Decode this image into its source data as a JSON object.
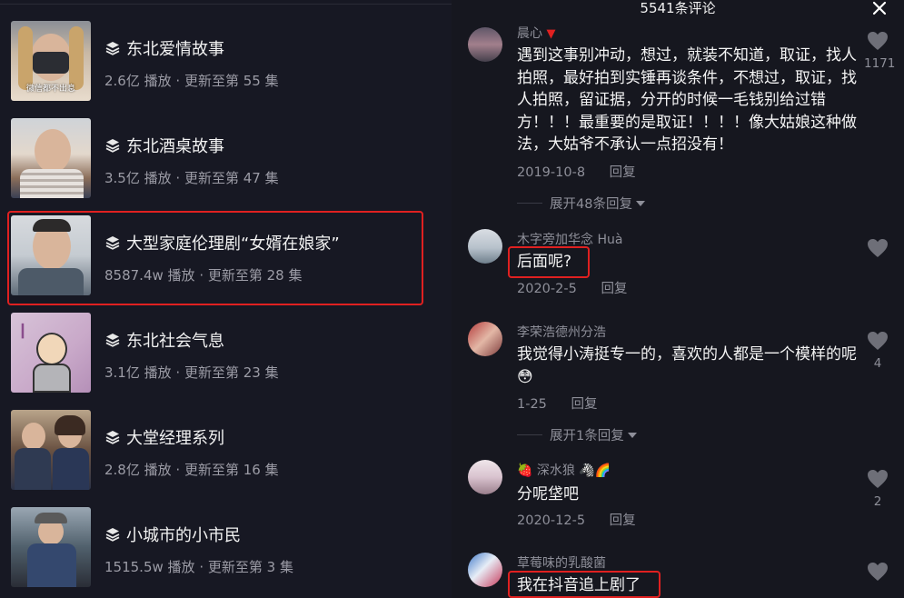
{
  "series": {
    "items": [
      {
        "title": "东北爱情故事",
        "plays": "2.6亿 播放",
        "update": "更新至第 55 集",
        "thumb_caption": "微信都不出息"
      },
      {
        "title": "东北酒桌故事",
        "plays": "3.5亿 播放",
        "update": "更新至第 47 集",
        "thumb_caption": ""
      },
      {
        "title": "大型家庭伦理剧“女婿在娘家”",
        "plays": "8587.4w 播放",
        "update": "更新至第 28 集",
        "thumb_caption": ""
      },
      {
        "title": "东北社会气息",
        "plays": "3.1亿 播放",
        "update": "更新至第 23 集",
        "thumb_caption": ""
      },
      {
        "title": "大堂经理系列",
        "plays": "2.8亿 播放",
        "update": "更新至第 16 集",
        "thumb_caption": ""
      },
      {
        "title": "小城市的小市民",
        "plays": "1515.5w 播放",
        "update": "更新至第 3 集",
        "thumb_caption": ""
      }
    ],
    "separator": "·",
    "highlighted_index": 2
  },
  "comments_panel": {
    "title": "5541条评论",
    "close_icon": "close-icon",
    "comments": [
      {
        "user": "晨心",
        "text": "遇到这事别冲动，想过，就装不知道，取证，找人拍照，最好拍到实锤再谈条件，不想过，取证，找人拍照，留证据，分开的时候一毛钱别给过错方！！！最重要的是取证！！！！像大姑娘这种做法，大姑爷不承认一点招没有！",
        "date": "2019-10-8",
        "reply": "回复",
        "likes": "1171",
        "expand": "展开48条回复"
      },
      {
        "user": "木字旁加华念 Huà",
        "text": "后面呢?",
        "date": "2020-2-5",
        "reply": "回复",
        "likes": ""
      },
      {
        "user": "李荣浩德州分浩",
        "text": "我觉得小涛挺专一的，喜欢的人都是一个模样的呢",
        "emoji": "😳",
        "date": "1-25",
        "reply": "回复",
        "likes": "4",
        "expand": "展开1条回复"
      },
      {
        "user": "深水狼",
        "user_prefix_emoji": "🍓",
        "user_suffix_emoji": "🦓🌈",
        "text": "分呢垡吧",
        "date": "2020-12-5",
        "reply": "回复",
        "likes": "2"
      },
      {
        "user": "草莓味的乳酸菌",
        "text": "我在抖音追上剧了",
        "likes": ""
      }
    ]
  },
  "colors": {
    "highlight": "#e02020",
    "background_left": "#171823",
    "background_right": "#16171f",
    "muted_text": "#8e8f99"
  }
}
